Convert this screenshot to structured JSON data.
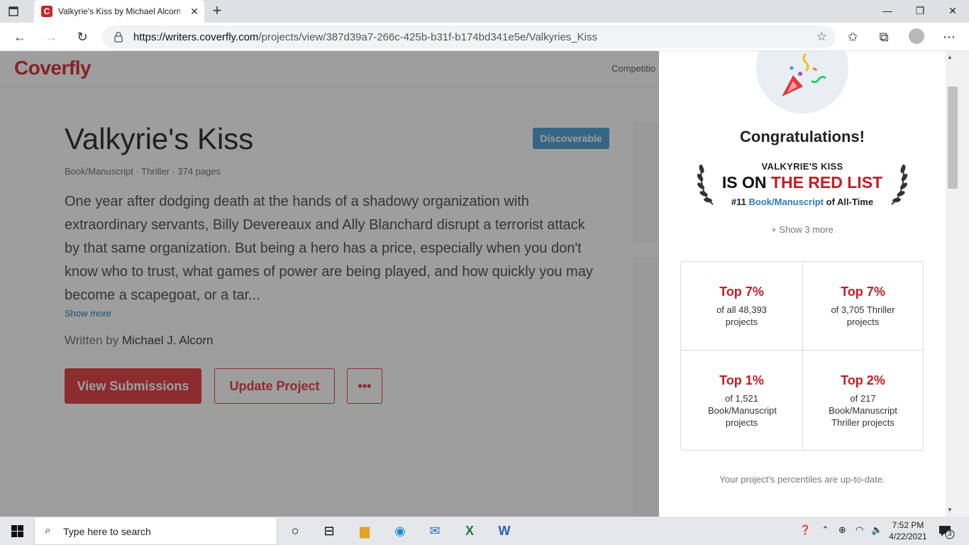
{
  "browser": {
    "tab_title": "Valkyrie's Kiss by Michael Alcorn",
    "tab_favicon_letter": "C",
    "url_host": "https://writers.coverfly.com",
    "url_path": "/projects/view/387d39a7-266c-425b-b31f-b174bd341e5e/Valkyries_Kiss"
  },
  "site": {
    "logo": "Coverfly",
    "nav_item": "Competitio"
  },
  "project": {
    "title": "Valkyrie's Kiss",
    "badge": "Discoverable",
    "meta": "Book/Manuscript · Thriller · 374 pages",
    "logline": "One year after dodging death at the hands of a shadowy organization with extraordinary servants, Billy Devereaux and Ally Blanchard disrupt a terrorist attack by that same organization. But being a hero has a price, especially when you don't know who to trust, what games of power are being played, and how quickly you may become a scapegoat, or a tar...",
    "show_more": "Show more",
    "written_by_label": "Written by",
    "author": "Michael J. Alcorn",
    "buttons": {
      "view_submissions": "View Submissions",
      "update_project": "Update Project",
      "more": "•••"
    }
  },
  "drawer": {
    "congrats": "Congratulations!",
    "red_list": {
      "project_name": "VALKYRIE'S KISS",
      "is_on": "IS ON",
      "the_red_list": "THE RED LIST",
      "rank_prefix": "#11",
      "rank_link": "Book/Manuscript",
      "rank_suffix": "of All-Time"
    },
    "show_more": "+ Show 3 more",
    "stats": [
      {
        "top": "Top 7%",
        "desc": "of all 48,393 projects"
      },
      {
        "top": "Top 7%",
        "desc": "of 3,705 Thriller projects"
      },
      {
        "top": "Top 1%",
        "desc": "of 1,521 Book/Manuscript projects"
      },
      {
        "top": "Top 2%",
        "desc": "of 217 Book/Manuscript Thriller projects"
      }
    ],
    "status": "Your project's percentiles are up-to-date."
  },
  "taskbar": {
    "search_placeholder": "Type here to search",
    "time": "7:52 PM",
    "date": "4/22/2021",
    "notification_count": "3"
  },
  "colors": {
    "brand_red": "#e2474c",
    "red_list": "#c41d23",
    "link_blue": "#2d7ab8",
    "badge_blue": "#5aa3d8"
  }
}
